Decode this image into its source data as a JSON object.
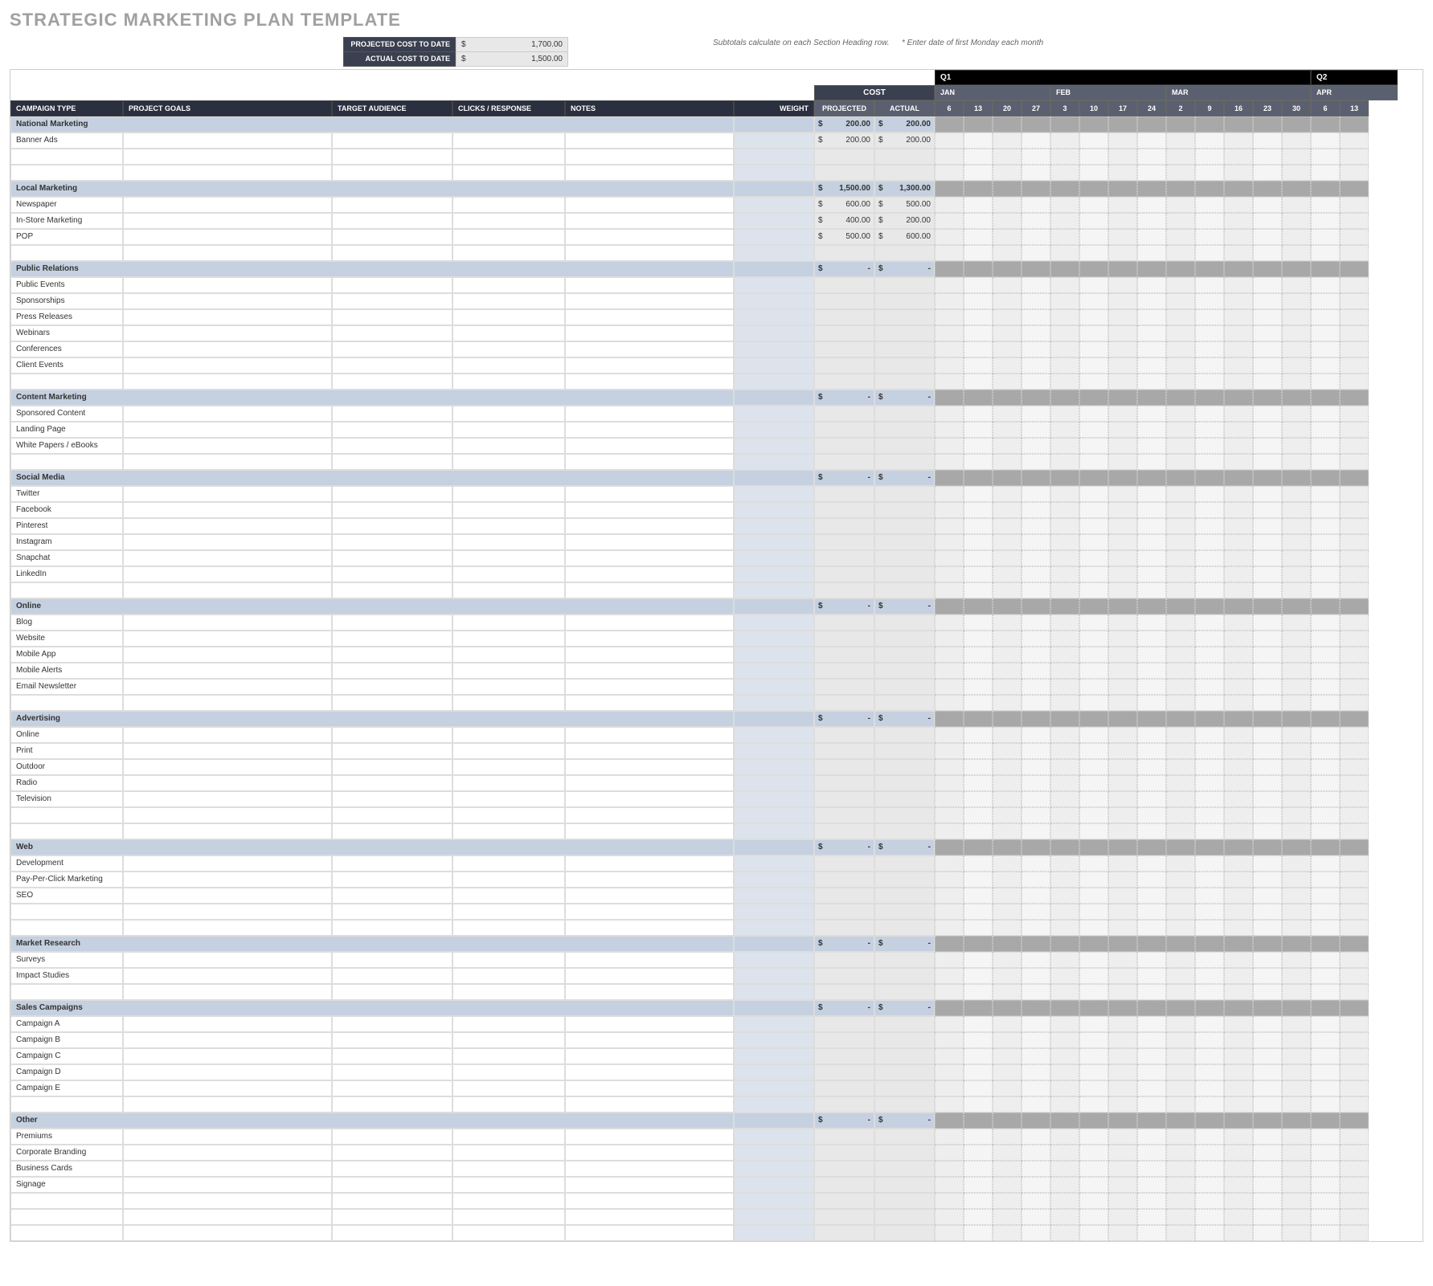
{
  "title": "STRATEGIC MARKETING PLAN TEMPLATE",
  "summary": {
    "projected_label": "PROJECTED COST TO DATE",
    "projected_value": "1,700.00",
    "actual_label": "ACTUAL COST TO DATE",
    "actual_value": "1,500.00",
    "subtotal_note": "Subtotals calculate on each Section Heading row.",
    "date_note": "* Enter date of first Monday each month"
  },
  "quarters": {
    "q1": "Q1",
    "q2": "Q2"
  },
  "months": [
    "JAN",
    "FEB",
    "MAR",
    "APR"
  ],
  "days": [
    "6",
    "13",
    "20",
    "27",
    "3",
    "10",
    "17",
    "24",
    "2",
    "9",
    "16",
    "23",
    "30",
    "6",
    "13"
  ],
  "columns": {
    "campaign_type": "CAMPAIGN TYPE",
    "project_goals": "PROJECT GOALS",
    "target_audience": "TARGET AUDIENCE",
    "clicks_response": "CLICKS / RESPONSE",
    "notes": "NOTES",
    "weight": "WEIGHT",
    "cost": "COST",
    "projected": "PROJECTED",
    "actual": "ACTUAL"
  },
  "sections": [
    {
      "name": "National Marketing",
      "projected": "200.00",
      "actual": "200.00",
      "rows": [
        {
          "name": "Banner Ads",
          "projected": "200.00",
          "actual": "200.00"
        },
        {
          "name": ""
        },
        {
          "name": ""
        }
      ]
    },
    {
      "name": "Local Marketing",
      "projected": "1,500.00",
      "actual": "1,300.00",
      "rows": [
        {
          "name": "Newspaper",
          "projected": "600.00",
          "actual": "500.00"
        },
        {
          "name": "In-Store Marketing",
          "projected": "400.00",
          "actual": "200.00"
        },
        {
          "name": "POP",
          "projected": "500.00",
          "actual": "600.00"
        },
        {
          "name": ""
        }
      ]
    },
    {
      "name": "Public Relations",
      "projected": "-",
      "actual": "-",
      "rows": [
        {
          "name": "Public Events"
        },
        {
          "name": "Sponsorships"
        },
        {
          "name": "Press Releases"
        },
        {
          "name": "Webinars"
        },
        {
          "name": "Conferences"
        },
        {
          "name": "Client Events"
        },
        {
          "name": ""
        }
      ]
    },
    {
      "name": "Content Marketing",
      "projected": "-",
      "actual": "-",
      "rows": [
        {
          "name": "Sponsored Content"
        },
        {
          "name": "Landing Page"
        },
        {
          "name": "White Papers / eBooks"
        },
        {
          "name": ""
        }
      ]
    },
    {
      "name": "Social Media",
      "projected": "-",
      "actual": "-",
      "rows": [
        {
          "name": "Twitter"
        },
        {
          "name": "Facebook"
        },
        {
          "name": "Pinterest"
        },
        {
          "name": "Instagram"
        },
        {
          "name": "Snapchat"
        },
        {
          "name": "LinkedIn"
        },
        {
          "name": ""
        }
      ]
    },
    {
      "name": "Online",
      "projected": "-",
      "actual": "-",
      "rows": [
        {
          "name": "Blog"
        },
        {
          "name": "Website"
        },
        {
          "name": "Mobile App"
        },
        {
          "name": "Mobile Alerts"
        },
        {
          "name": "Email Newsletter"
        },
        {
          "name": ""
        }
      ]
    },
    {
      "name": "Advertising",
      "projected": "-",
      "actual": "-",
      "rows": [
        {
          "name": "Online"
        },
        {
          "name": "Print"
        },
        {
          "name": "Outdoor"
        },
        {
          "name": "Radio"
        },
        {
          "name": "Television"
        },
        {
          "name": ""
        },
        {
          "name": ""
        }
      ]
    },
    {
      "name": "Web",
      "projected": "-",
      "actual": "-",
      "rows": [
        {
          "name": "Development"
        },
        {
          "name": "Pay-Per-Click Marketing"
        },
        {
          "name": "SEO"
        },
        {
          "name": ""
        },
        {
          "name": ""
        }
      ]
    },
    {
      "name": "Market Research",
      "projected": "-",
      "actual": "-",
      "rows": [
        {
          "name": "Surveys"
        },
        {
          "name": "Impact Studies"
        },
        {
          "name": ""
        }
      ]
    },
    {
      "name": "Sales Campaigns",
      "projected": "-",
      "actual": "-",
      "rows": [
        {
          "name": "Campaign A"
        },
        {
          "name": "Campaign B"
        },
        {
          "name": "Campaign C"
        },
        {
          "name": "Campaign D"
        },
        {
          "name": "Campaign E"
        },
        {
          "name": ""
        }
      ]
    },
    {
      "name": "Other",
      "projected": "-",
      "actual": "-",
      "rows": [
        {
          "name": "Premiums"
        },
        {
          "name": "Corporate Branding"
        },
        {
          "name": "Business Cards"
        },
        {
          "name": "Signage"
        },
        {
          "name": ""
        },
        {
          "name": ""
        },
        {
          "name": ""
        }
      ]
    }
  ]
}
